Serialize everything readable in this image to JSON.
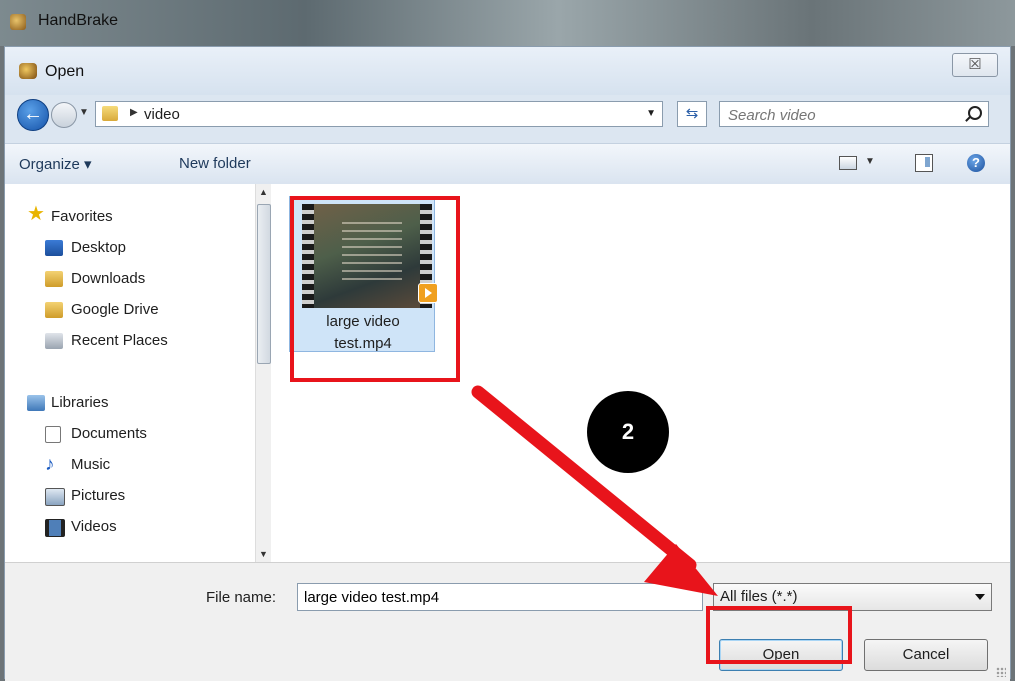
{
  "background_window": {
    "title": "HandBrake"
  },
  "dialog": {
    "title": "Open",
    "close_glyph": "☒",
    "address": {
      "crumb": "video"
    },
    "search": {
      "placeholder": "Search video"
    },
    "toolbar": {
      "organize": "Organize ▾",
      "new_folder": "New folder"
    },
    "nav": {
      "favorites_header": "Favorites",
      "favorites": [
        "Desktop",
        "Downloads",
        "Google Drive",
        "Recent Places"
      ],
      "libraries_header": "Libraries",
      "libraries": [
        "Documents",
        "Music",
        "Pictures",
        "Videos"
      ]
    },
    "files": [
      {
        "name": "large video test.mp4",
        "label_line1": "large video",
        "label_line2": "test.mp4"
      }
    ],
    "filename": {
      "label": "File name:",
      "value": "large video test.mp4"
    },
    "file_type": {
      "selected": "All files (*.*)"
    },
    "buttons": {
      "open": "Open",
      "cancel": "Cancel"
    }
  },
  "annotation": {
    "step_number": "2",
    "highlight_color": "#e8141b"
  }
}
